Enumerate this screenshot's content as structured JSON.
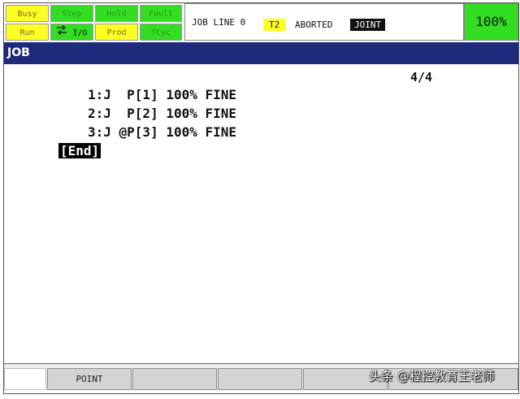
{
  "status": {
    "row1": [
      "Busy",
      "Step",
      "Hold",
      "Fault"
    ],
    "row2": [
      "Run",
      "I/O",
      "Prod",
      "TCyc"
    ],
    "row1_on": [
      true,
      false,
      false,
      false
    ],
    "row2_on": [
      true,
      false,
      true,
      false
    ]
  },
  "jobline": {
    "label": "JOB LINE 0",
    "mode": "T2",
    "state": "ABORTED",
    "coord": "JOINT"
  },
  "override": "100%",
  "title": "JOB",
  "program": {
    "position": "4/4",
    "lines": [
      "1:J  P[1] 100% FINE",
      "2:J  P[2] 100% FINE",
      "3:J @P[3] 100% FINE"
    ],
    "end": "[End]"
  },
  "function_keys": [
    "",
    "POINT",
    "",
    "",
    "",
    ""
  ],
  "watermark": "头条 @程控教育王老师",
  "colors": {
    "status_on": "#ffff22",
    "status_off": "#33dd22",
    "title_bar": "#1f2b7a",
    "override_bg": "#33dd22"
  },
  "icons": {
    "io": "io-arrows-icon"
  }
}
